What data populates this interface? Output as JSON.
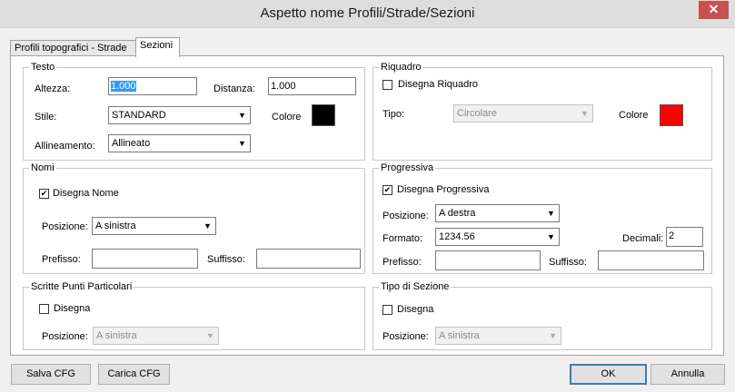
{
  "window": {
    "title": "Aspetto nome Profili/Strade/Sezioni",
    "close_glyph": "✕"
  },
  "tabs": [
    {
      "label": "Profili topografici - Strade",
      "active": false
    },
    {
      "label": "Sezioni",
      "active": true
    }
  ],
  "testo": {
    "legend": "Testo",
    "altezza_label": "Altezza:",
    "altezza_value": "1.000",
    "distanza_label": "Distanza:",
    "distanza_value": "1.000",
    "stile_label": "Stile:",
    "stile_value": "STANDARD",
    "colore_label": "Colore",
    "colore_hex": "#000000",
    "allineamento_label": "Allineamento:",
    "allineamento_value": "Allineato"
  },
  "riquadro": {
    "legend": "Riquadro",
    "disegna_label": "Disegna Riquadro",
    "disegna_checked": false,
    "tipo_label": "Tipo:",
    "tipo_value": "Circolare",
    "colore_label": "Colore",
    "colore_hex": "#ff0000"
  },
  "nomi": {
    "legend": "Nomi",
    "disegna_label": "Disegna Nome",
    "disegna_checked": true,
    "posizione_label": "Posizione:",
    "posizione_value": "A sinistra",
    "prefisso_label": "Prefisso:",
    "prefisso_value": "",
    "suffisso_label": "Suffisso:",
    "suffisso_value": ""
  },
  "progressiva": {
    "legend": "Progressiva",
    "disegna_label": "Disegna Progressiva",
    "disegna_checked": true,
    "posizione_label": "Posizione:",
    "posizione_value": "A destra",
    "formato_label": "Formato:",
    "formato_value": "1234.56",
    "decimali_label": "Decimali:",
    "decimali_value": "2",
    "prefisso_label": "Prefisso:",
    "prefisso_value": "",
    "suffisso_label": "Suffisso:",
    "suffisso_value": ""
  },
  "scritte": {
    "legend": "Scritte Punti Particolari",
    "disegna_label": "Disegna",
    "disegna_checked": false,
    "posizione_label": "Posizione:",
    "posizione_value": "A sinistra"
  },
  "tipo_sezione": {
    "legend": "Tipo di Sezione",
    "disegna_label": "Disegna",
    "disegna_checked": false,
    "posizione_label": "Posizione:",
    "posizione_value": "A sinistra"
  },
  "buttons": {
    "salva": "Salva CFG",
    "carica": "Carica CFG",
    "ok": "OK",
    "annulla": "Annulla"
  },
  "icons": {
    "dropdown_arrow": "▼",
    "check_mark": "✔"
  }
}
